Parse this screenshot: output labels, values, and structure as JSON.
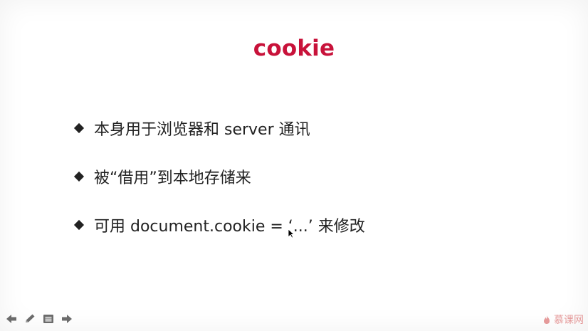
{
  "slide": {
    "title": "cookie",
    "bullets": [
      "本身用于浏览器和 server 通讯",
      "被“借用”到本地存储来",
      "可用 document.cookie = ‘...’ 来修改"
    ]
  },
  "controls": {
    "prev_icon": "arrow-left-icon",
    "pen_icon": "pencil-icon",
    "menu_icon": "slide-menu-icon",
    "next_icon": "arrow-right-icon"
  },
  "watermark": {
    "text": "慕课网",
    "icon": "flame-logo-icon"
  },
  "colors": {
    "title": "#c8123a",
    "text": "#222222",
    "controls": "#6b6b6b",
    "watermark": "#e18a8a"
  }
}
